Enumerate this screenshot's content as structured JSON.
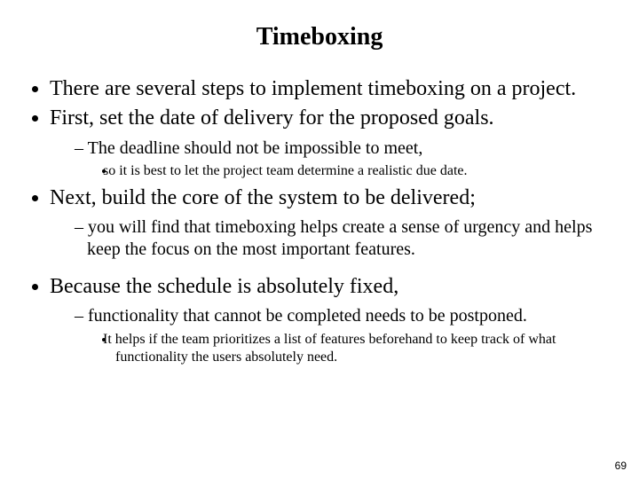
{
  "title": "Timeboxing",
  "bullets": {
    "b1": "There are several steps to implement timeboxing on a project.",
    "b2": "First, set the date of delivery for the proposed goals.",
    "b2_1": "The deadline should not be impossible to meet,",
    "b2_1_1": "so it is best to let the project team determine a realistic due date.",
    "b3": "Next, build the core of the system to be delivered;",
    "b3_1": "you will find that timeboxing helps create a sense of urgency and helps keep the focus on the most important features.",
    "b4": "Because the schedule is absolutely fixed,",
    "b4_1": "functionality that cannot be completed needs to be postponed.",
    "b4_1_1": "It helps if the team prioritizes a list of features beforehand to keep track of what functionality the users absolutely need."
  },
  "page_number": "69"
}
